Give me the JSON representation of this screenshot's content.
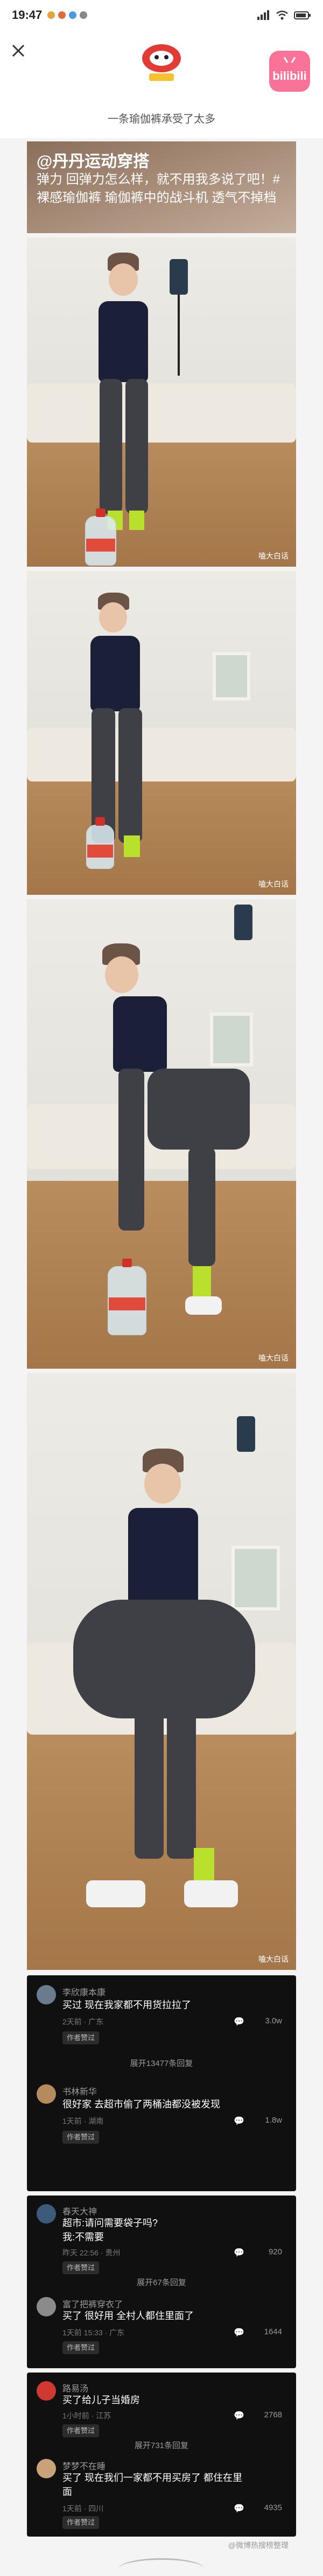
{
  "status": {
    "time": "19:47"
  },
  "header": {
    "subtitle": "一条瑜伽裤承受了太多",
    "badge_text": "bilibili"
  },
  "caption": {
    "title": "@丹丹运动穿搭",
    "body": "弹力 回弹力怎么样，就不用我多说了吧！#裸感瑜伽裤 瑜伽裤中的战斗机 透气不掉档"
  },
  "photos": [
    {
      "watermark": "嗑大白话"
    },
    {
      "watermark": "嗑大白话"
    },
    {
      "watermark": "嗑大白话"
    },
    {
      "watermark": "嗑大白话"
    }
  ],
  "comments": [
    {
      "items": [
        {
          "name": "李欣康本康",
          "text": "买过 现在我家都不用货拉拉了",
          "meta": "2天前 · 广东",
          "reply": "作者赞过",
          "likes": "3.0w"
        },
        {
          "name": "书林新华",
          "text": "很好家 去超市偷了两桶油都没被发现",
          "meta": "1天前 · 湖南",
          "reply": "作者赞过",
          "likes": "1.8w"
        }
      ],
      "expand": "展开13477条回复"
    },
    {
      "items": [
        {
          "name": "春天大神",
          "text": "超市:请问需要袋子吗?\n我:不需要",
          "meta": "昨天 22:56 · 贵州",
          "reply": "作者赞过",
          "likes": "920"
        },
        {
          "name": "富了把裤穿衣了",
          "text": "买了 很好用 全村人都住里面了",
          "meta": "1天前 15:33 · 广东",
          "reply": "作者赞过",
          "likes": "1644"
        }
      ],
      "expand": "展开67条回复"
    },
    {
      "items": [
        {
          "name": "路易汤",
          "text": "买了给儿子当婚房",
          "meta": "1小时前 · 江苏",
          "reply": "作者赞过",
          "likes": "2768"
        },
        {
          "name": "梦梦不在睡",
          "text": "买了 现在我们一家都不用买房了 都住在里面",
          "meta": "1天前 · 四川",
          "reply": "作者赞过",
          "likes": "4935"
        }
      ],
      "expand": "展开731条回复"
    }
  ],
  "footer": {
    "watermark": "@微博热搜榜整理"
  },
  "colors": {
    "accent": "#fb7299",
    "sock": "#b8e02c",
    "pants": "#3f4045",
    "top": "#1b2038"
  }
}
